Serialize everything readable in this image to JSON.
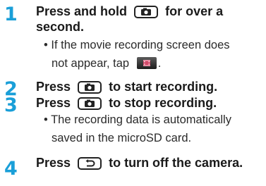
{
  "steps": [
    {
      "number": "1",
      "lines": [
        "for over a",
        "second."
      ],
      "pre": "Press and hold",
      "key_icon": "camera-key-icon",
      "note_line1": "If the movie recording screen does",
      "note_line2_pre": "not appear, tap",
      "note_line2_post": ".",
      "note_icon": "movie-mode-icon"
    },
    {
      "number": "2",
      "pre": "Press",
      "post": "to start recording.",
      "key_icon": "camera-key-icon"
    },
    {
      "number": "3",
      "pre": "Press",
      "post": "to stop recording.",
      "key_icon": "camera-key-icon",
      "note_line1": "The recording data is automatically",
      "note_line2": "saved in the microSD card."
    },
    {
      "number": "4",
      "pre": "Press",
      "post": "to turn off the camera.",
      "key_icon": "back-key-icon"
    }
  ],
  "bullet": "•",
  "colors": {
    "step_number": "#1a9fd8",
    "text": "#1a1a1a"
  }
}
